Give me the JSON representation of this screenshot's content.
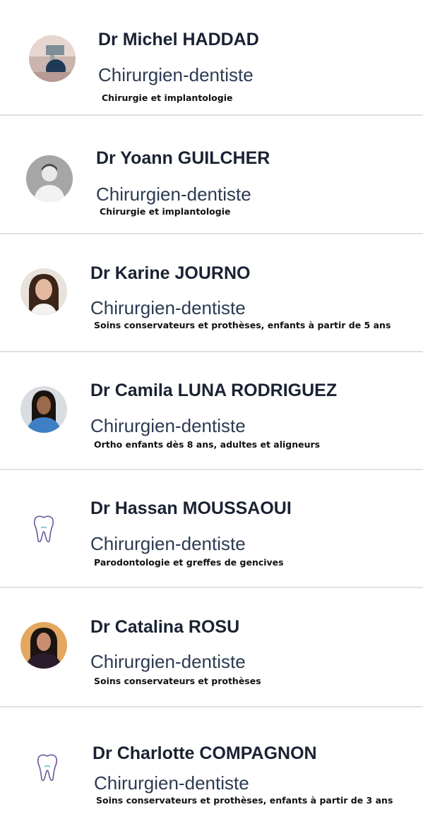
{
  "doctors": [
    {
      "name": "Dr Michel HADDAD",
      "role": "Chirurgien-dentiste",
      "specialty": "Chirurgie et implantologie",
      "avatar": "photo-avatar"
    },
    {
      "name": "Dr Yoann GUILCHER",
      "role": "Chirurgien-dentiste",
      "specialty": "Chirurgie et implantologie",
      "avatar": "photo-avatar"
    },
    {
      "name": "Dr Karine JOURNO",
      "role": "Chirurgien-dentiste",
      "specialty": "Soins conservateurs et prothèses, enfants à partir de 5 ans",
      "avatar": "photo-avatar"
    },
    {
      "name": "Dr Camila LUNA RODRIGUEZ",
      "role": "Chirurgien-dentiste",
      "specialty": "Ortho enfants dès 8 ans, adultes et aligneurs",
      "avatar": "photo-avatar"
    },
    {
      "name": "Dr Hassan MOUSSAOUI",
      "role": "Chirurgien-dentiste",
      "specialty": "Parodontologie et greffes de gencives",
      "avatar": "tooth-icon"
    },
    {
      "name": "Dr Catalina ROSU",
      "role": "Chirurgien-dentiste",
      "specialty": "Soins conservateurs et prothèses",
      "avatar": "photo-avatar"
    },
    {
      "name": "Dr Charlotte COMPAGNON",
      "role": "Chirurgien-dentiste",
      "specialty": "Soins conservateurs et prothèses, enfants à partir de 3 ans",
      "avatar": "tooth-icon"
    }
  ],
  "colors": {
    "name": "#1a2233",
    "role": "#2d3b52",
    "divider": "#dde1e8",
    "tooth_stroke": "#6a5a9e"
  }
}
